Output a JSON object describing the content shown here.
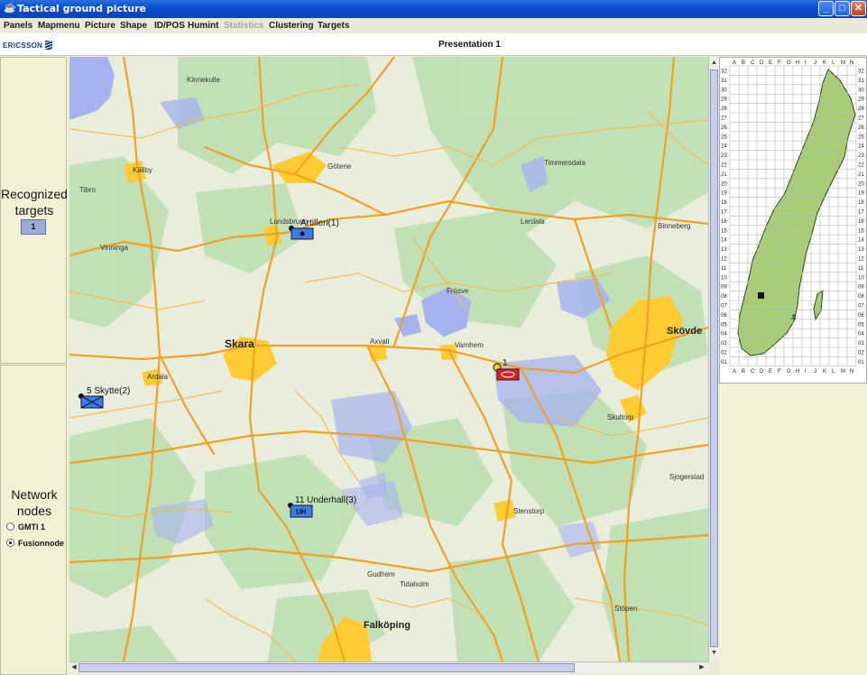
{
  "window": {
    "title": "Tactical ground picture",
    "minimize": "_",
    "maximize": "□",
    "close": "✕"
  },
  "menu": [
    "Panels",
    "Mapmenu",
    "Picture",
    "Shape",
    "ID/POS",
    "Humint",
    "Statistics",
    "Clustering",
    "Targets"
  ],
  "menu_disabled": [
    "Statistics"
  ],
  "header": {
    "logo": "ERICSSON",
    "presentation": "Presentation 1"
  },
  "left_panel": {
    "recognized_line1": "Recognized",
    "recognized_line2": "targets",
    "recognized_count": "1",
    "network_line1": "Network",
    "network_line2": "nodes",
    "nodes": [
      {
        "label": "GMTI 1",
        "selected": false
      },
      {
        "label": "Fusionnode",
        "selected": true
      }
    ]
  },
  "map": {
    "cities": {
      "skara": "Skara",
      "skovde": "Skövde",
      "falkoping": "Falköping"
    },
    "towns": [
      "Götene",
      "Lundsbrunn",
      "Källby",
      "Vinninga",
      "Axvall",
      "Varnhem",
      "Timmersdala",
      "Lerdala",
      "Binneberg",
      "Skultorp",
      "Stenstorp",
      "Ardala",
      "Gudhem",
      "Tidaholm",
      "Sjogerstad",
      "Frösve",
      "Stöpen",
      "Tibro",
      "Kinnekulle"
    ],
    "units": [
      {
        "label": "Artilleri(1)",
        "type": "artillery",
        "color": "#3c7ee8"
      },
      {
        "label": "5 Skytte(2)",
        "type": "infantry",
        "color": "#3c7ee8"
      },
      {
        "label": "11 Underhall(3)",
        "type": "supply",
        "color": "#3c7ee8",
        "code": "UH"
      },
      {
        "label": "1",
        "type": "hostile-armor",
        "color": "#e02020"
      }
    ]
  },
  "overview": {
    "col_labels": [
      "A",
      "B",
      "C",
      "D",
      "E",
      "F",
      "G",
      "H",
      "I",
      "J",
      "K",
      "L",
      "M",
      "N"
    ],
    "row_labels": [
      "32",
      "31",
      "30",
      "29",
      "28",
      "27",
      "26",
      "25",
      "24",
      "23",
      "22",
      "21",
      "20",
      "19",
      "18",
      "17",
      "16",
      "15",
      "14",
      "13",
      "12",
      "11",
      "10",
      "09",
      "08",
      "07",
      "06",
      "05",
      "04",
      "03",
      "02",
      "01"
    ],
    "row_labels_right": [
      "32",
      "31",
      "30",
      "29",
      "28",
      "27",
      "26",
      "25",
      "24",
      "23",
      "22",
      "21",
      "20",
      "19",
      "18",
      "17",
      "16",
      "15",
      "14",
      "13",
      "12",
      "11",
      "10",
      "09",
      "08",
      "07",
      "06",
      "05",
      "04",
      "03",
      "02",
      "01"
    ],
    "land_color": "#a5cf72"
  },
  "colors": {
    "water": "#a6b3f0",
    "urban": "#ffcc33",
    "road": "#f2a021",
    "forest": "#b8ddb0",
    "field": "#eef0dc"
  }
}
